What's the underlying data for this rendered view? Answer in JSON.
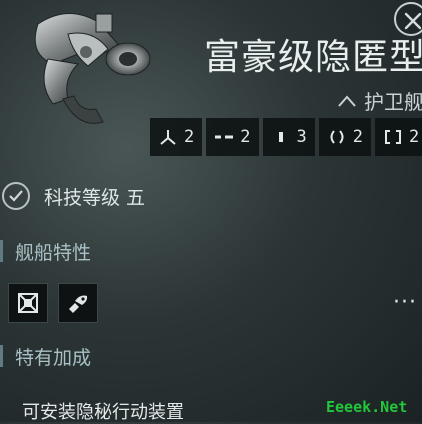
{
  "header": {
    "title": "富豪级隐匿型",
    "ship_class": "护卫舰",
    "close_icon": "close-icon"
  },
  "slots": [
    {
      "icon": "turret-hardpoint-icon",
      "value": "2"
    },
    {
      "icon": "launcher-hardpoint-icon",
      "value": "2"
    },
    {
      "icon": "high-slot-icon",
      "value": "3"
    },
    {
      "icon": "mid-slot-icon",
      "value": "2"
    },
    {
      "icon": "low-slot-icon",
      "value": "2"
    }
  ],
  "tech": {
    "label": "科技等级 五"
  },
  "ship_traits": {
    "heading": "舰船特性",
    "buttons": [
      "covert-module-icon",
      "skill-book-icon"
    ],
    "more": "···"
  },
  "bonuses": {
    "heading": "特有加成",
    "first_item": "可安装隐秘行动装置"
  },
  "watermark": "Eeeek.Net",
  "colors": {
    "background": "#2c3536",
    "section_heading": "#a9c0c4",
    "accent_bar": "#5e7c82",
    "watermark": "#23c63a"
  }
}
